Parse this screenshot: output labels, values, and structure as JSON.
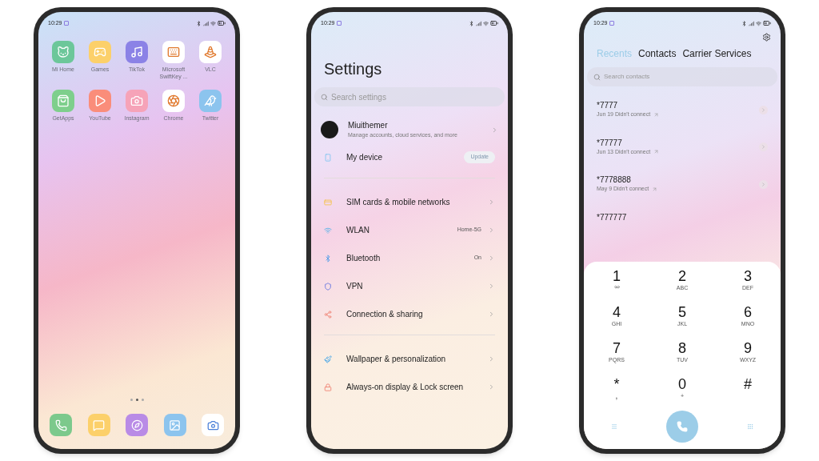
{
  "home_screen": {
    "status_bar": {
      "time": "10:29"
    },
    "apps": [
      {
        "label": "Mi Home",
        "color": "#6cc79a"
      },
      {
        "label": "Games",
        "color": "#fcd06a"
      },
      {
        "label": "TikTok",
        "color": "#8b82e6"
      },
      {
        "label": "Microsoft SwiftKey ...",
        "color": "#ffffff"
      },
      {
        "label": "VLC",
        "color": "#ffffff"
      },
      {
        "label": "GetApps",
        "color": "#7ecf8c"
      },
      {
        "label": "YouTube",
        "color": "#fa8d7a"
      },
      {
        "label": "Instagram",
        "color": "#f6a3b8"
      },
      {
        "label": "Chrome",
        "color": "#ffffff"
      },
      {
        "label": "Twitter",
        "color": "#8cc4ee"
      }
    ],
    "page_dots": [
      {
        "selected": false
      },
      {
        "selected": true
      },
      {
        "selected": false
      }
    ],
    "dock": [
      {
        "color": "#7cc98c"
      },
      {
        "color": "#fcd06a"
      },
      {
        "color": "#b98be6"
      },
      {
        "color": "#8cc4ee"
      },
      {
        "color": "#ffffff"
      }
    ]
  },
  "settings_screen": {
    "status_bar": {
      "time": "10:29"
    },
    "title": "Settings",
    "search": {
      "placeholder": "Search settings"
    },
    "account": {
      "name": "Miuithemer",
      "subtitle": "Manage accounts, cloud services, and more"
    },
    "groups": [
      [
        {
          "label": "My device",
          "badge": "Update"
        }
      ],
      [
        {
          "label": "SIM cards & mobile networks"
        },
        {
          "label": "WLAN",
          "value": "Home-5G"
        },
        {
          "label": "Bluetooth",
          "value": "On"
        },
        {
          "label": "VPN"
        },
        {
          "label": "Connection & sharing"
        }
      ],
      [
        {
          "label": "Wallpaper & personalization"
        },
        {
          "label": "Always-on display & Lock screen"
        }
      ]
    ]
  },
  "phone_screen": {
    "status_bar": {
      "time": "10:29"
    },
    "tabs": [
      {
        "label": "Recents",
        "selected": true
      },
      {
        "label": "Contacts",
        "selected": false
      },
      {
        "label": "Carrier Services",
        "selected": false
      }
    ],
    "search": {
      "placeholder": "Search contacts"
    },
    "calls": [
      {
        "number": "*7777",
        "detail": "Jun 19 Didn't connect"
      },
      {
        "number": "*77777",
        "detail": "Jun 13 Didn't connect"
      },
      {
        "number": "*7778888",
        "detail": "May 9 Didn't connect"
      },
      {
        "number": "*777777"
      }
    ],
    "keys": [
      {
        "digit": "1",
        "kind": "voicemail"
      },
      {
        "digit": "2",
        "letters": "ABC"
      },
      {
        "digit": "3",
        "letters": "DEF"
      },
      {
        "digit": "4",
        "letters": "GHI"
      },
      {
        "digit": "5",
        "letters": "JKL"
      },
      {
        "digit": "6",
        "letters": "MNO"
      },
      {
        "digit": "7",
        "letters": "PQRS"
      },
      {
        "digit": "8",
        "letters": "TUV"
      },
      {
        "digit": "9",
        "letters": "WXYZ"
      },
      {
        "digit": "*",
        "letters": ","
      },
      {
        "digit": "0",
        "letters": "+"
      },
      {
        "digit": "#"
      }
    ]
  }
}
